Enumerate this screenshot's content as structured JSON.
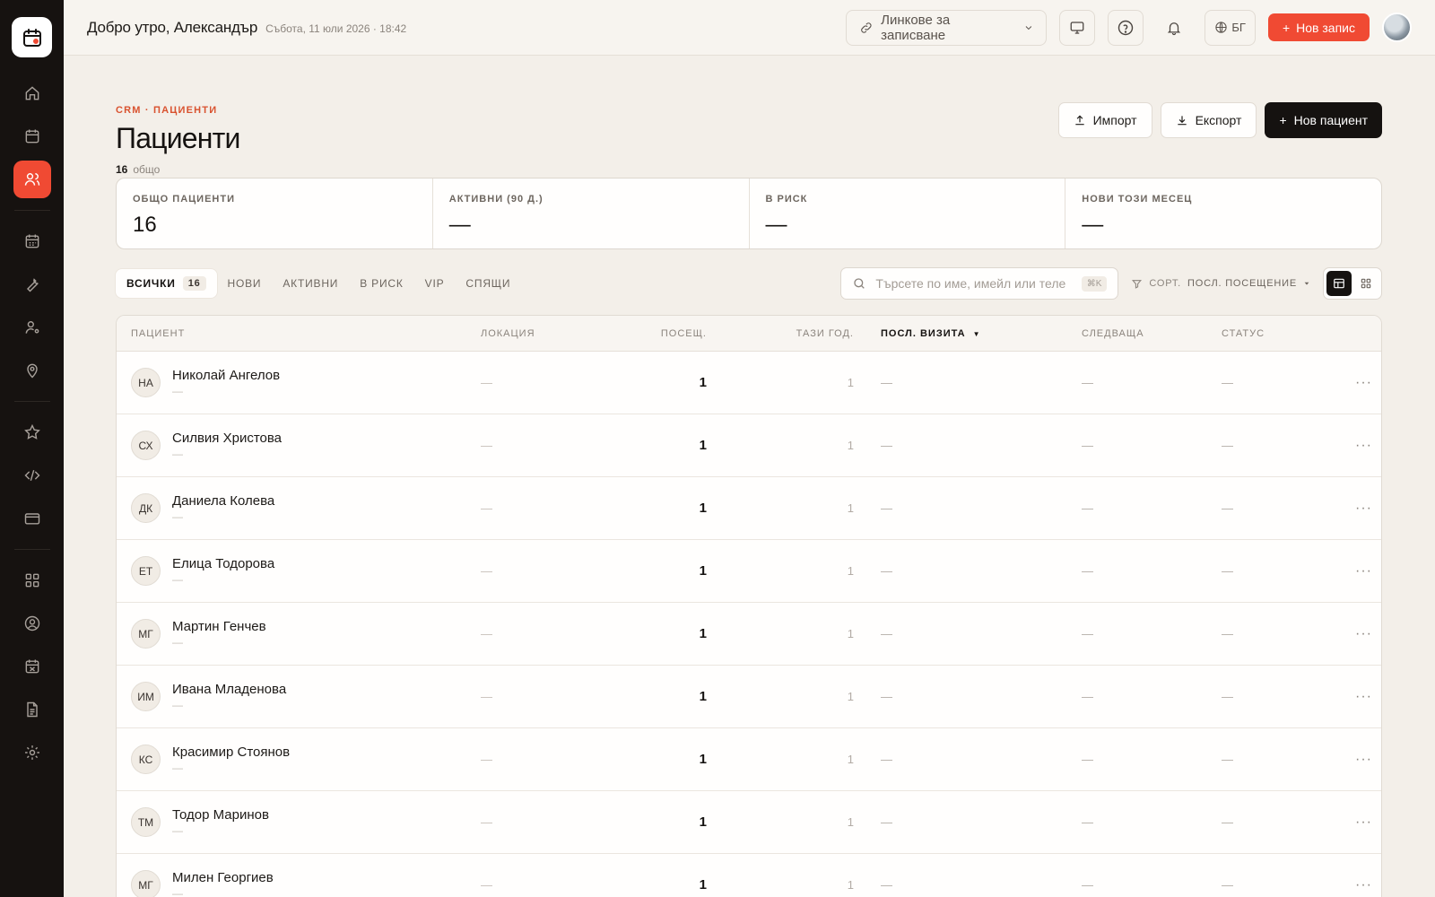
{
  "sidebar": {
    "items": [
      {
        "icon": "home-icon"
      },
      {
        "icon": "calendar-icon"
      },
      {
        "icon": "users-icon",
        "active": true
      },
      {
        "icon": "calendar-grid-icon"
      },
      {
        "icon": "wrench-icon"
      },
      {
        "icon": "user-cog-icon"
      },
      {
        "icon": "map-pin-icon"
      },
      {
        "icon": "star-icon"
      },
      {
        "icon": "code-icon"
      },
      {
        "icon": "credit-card-icon"
      },
      {
        "icon": "grid-icon"
      },
      {
        "icon": "user-circle-icon"
      },
      {
        "icon": "calendar-off-icon"
      },
      {
        "icon": "file-text-icon"
      },
      {
        "icon": "settings-icon"
      }
    ]
  },
  "header": {
    "greeting": "Добро утро, Александър",
    "date": "Събота, 11 юли 2026 · 18:42",
    "booking_links": "Линкове за записване",
    "lang": "БГ",
    "new_record": "Нов запис"
  },
  "page": {
    "breadcrumb": "CRM · ПАЦИЕНТИ",
    "title": "Пациенти",
    "count": "16",
    "count_label": "общо",
    "import_label": "Импорт",
    "export_label": "Експорт",
    "new_patient_label": "Нов пациент"
  },
  "stats": [
    {
      "label": "ОБЩО ПАЦИЕНТИ",
      "value": "16"
    },
    {
      "label": "АКТИВНИ (90 Д.)",
      "value": "—"
    },
    {
      "label": "В РИСК",
      "value": "—"
    },
    {
      "label": "НОВИ ТОЗИ МЕСЕЦ",
      "value": "—"
    }
  ],
  "tabs": [
    {
      "label": "ВСИЧКИ",
      "count": "16",
      "active": true
    },
    {
      "label": "НОВИ"
    },
    {
      "label": "АКТИВНИ"
    },
    {
      "label": "В РИСК"
    },
    {
      "label": "VIP"
    },
    {
      "label": "СПЯЩИ"
    }
  ],
  "search": {
    "placeholder": "Търсете по име, имейл или теле",
    "shortcut": "⌘K"
  },
  "sort": {
    "label": "СОРТ.",
    "value": "ПОСЛ. ПОСЕЩЕНИЕ"
  },
  "table": {
    "columns": {
      "patient": "ПАЦИЕНТ",
      "location": "ЛОКАЦИЯ",
      "visits": "ПОСЕЩ.",
      "this_year": "ТАЗИ ГОД.",
      "last_visit": "ПОСЛ. ВИЗИТА",
      "next": "СЛЕДВАЩА",
      "status": "СТАТУС"
    },
    "rows": [
      {
        "initials": "НА",
        "name": "Николай Ангелов",
        "sub": "—",
        "location": "—",
        "visits": "1",
        "year": "1",
        "last": "—",
        "next": "—",
        "status": "—"
      },
      {
        "initials": "СХ",
        "name": "Силвия Христова",
        "sub": "—",
        "location": "—",
        "visits": "1",
        "year": "1",
        "last": "—",
        "next": "—",
        "status": "—"
      },
      {
        "initials": "ДК",
        "name": "Даниела Колева",
        "sub": "—",
        "location": "—",
        "visits": "1",
        "year": "1",
        "last": "—",
        "next": "—",
        "status": "—"
      },
      {
        "initials": "ЕТ",
        "name": "Елица Тодорова",
        "sub": "—",
        "location": "—",
        "visits": "1",
        "year": "1",
        "last": "—",
        "next": "—",
        "status": "—"
      },
      {
        "initials": "МГ",
        "name": "Мартин Генчев",
        "sub": "—",
        "location": "—",
        "visits": "1",
        "year": "1",
        "last": "—",
        "next": "—",
        "status": "—"
      },
      {
        "initials": "ИМ",
        "name": "Ивана Младенова",
        "sub": "—",
        "location": "—",
        "visits": "1",
        "year": "1",
        "last": "—",
        "next": "—",
        "status": "—"
      },
      {
        "initials": "КС",
        "name": "Красимир Стоянов",
        "sub": "—",
        "location": "—",
        "visits": "1",
        "year": "1",
        "last": "—",
        "next": "—",
        "status": "—"
      },
      {
        "initials": "ТМ",
        "name": "Тодор Маринов",
        "sub": "—",
        "location": "—",
        "visits": "1",
        "year": "1",
        "last": "—",
        "next": "—",
        "status": "—"
      },
      {
        "initials": "МГ",
        "name": "Милен Георгиев",
        "sub": "—",
        "location": "—",
        "visits": "1",
        "year": "1",
        "last": "—",
        "next": "—",
        "status": "—"
      }
    ]
  },
  "colors": {
    "accent": "#f04a33",
    "sidebar": "#161210",
    "background": "#f3efe9"
  }
}
